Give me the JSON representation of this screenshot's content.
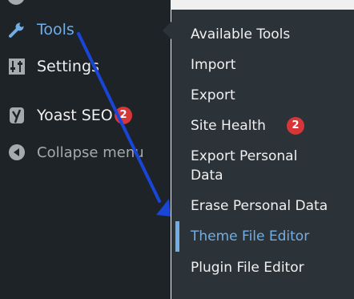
{
  "colors": {
    "sidebar_bg": "#1d2327",
    "submenu_bg": "#2c3338",
    "highlight": "#72aee6",
    "badge": "#d63638",
    "annotation_arrow": "#1a46d8"
  },
  "sidebar": {
    "items": [
      {
        "label": "Tools",
        "icon": "wrench-icon",
        "active": true
      },
      {
        "label": "Settings",
        "icon": "sliders-icon"
      },
      {
        "label": "Yoast SEO",
        "icon": "yoast-icon",
        "badge": "2"
      },
      {
        "label": "Collapse menu",
        "icon": "collapse-arrow-icon"
      }
    ]
  },
  "submenu": {
    "items": [
      {
        "label": "Available Tools"
      },
      {
        "label": "Import"
      },
      {
        "label": "Export"
      },
      {
        "label": "Site Health",
        "badge": "2"
      },
      {
        "label": "Export Personal Data"
      },
      {
        "label": "Erase Personal Data"
      },
      {
        "label": "Theme File Editor",
        "current": true
      },
      {
        "label": "Plugin File Editor"
      }
    ]
  }
}
